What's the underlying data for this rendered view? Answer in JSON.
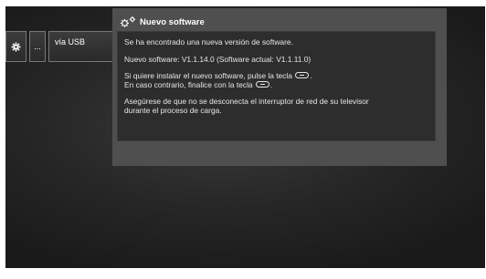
{
  "menu": {
    "icon": "gear-icon",
    "dots_label": "...",
    "usb_label": "vía USB"
  },
  "dialog": {
    "icon": "update-gears-icon",
    "title": "Nuevo software",
    "line_found": "Se ha encontrado una nueva versión de software.",
    "new_software": "Nuevo software:  V1.1.14.0  (Software actual:  V1.1.11.0)",
    "install_prefix": "Si quiere instalar el nuevo software, pulse la tecla",
    "install_key_icon": "ok-key-icon",
    "install_suffix": ".",
    "cancel_prefix": "En caso contrario, finalice con la tecla",
    "cancel_key_icon": "exit-key-icon",
    "cancel_suffix": ".",
    "warning_line1": "Asegúrese de que no se desconecta el interruptor de red de su televisor",
    "warning_line2": "durante el proceso de carga."
  },
  "colors": {
    "screen_bg": "#262626",
    "dialog_bg": "#4f4f4f",
    "dialog_body_bg": "#2d2d2d",
    "text": "#e6e6e6"
  }
}
